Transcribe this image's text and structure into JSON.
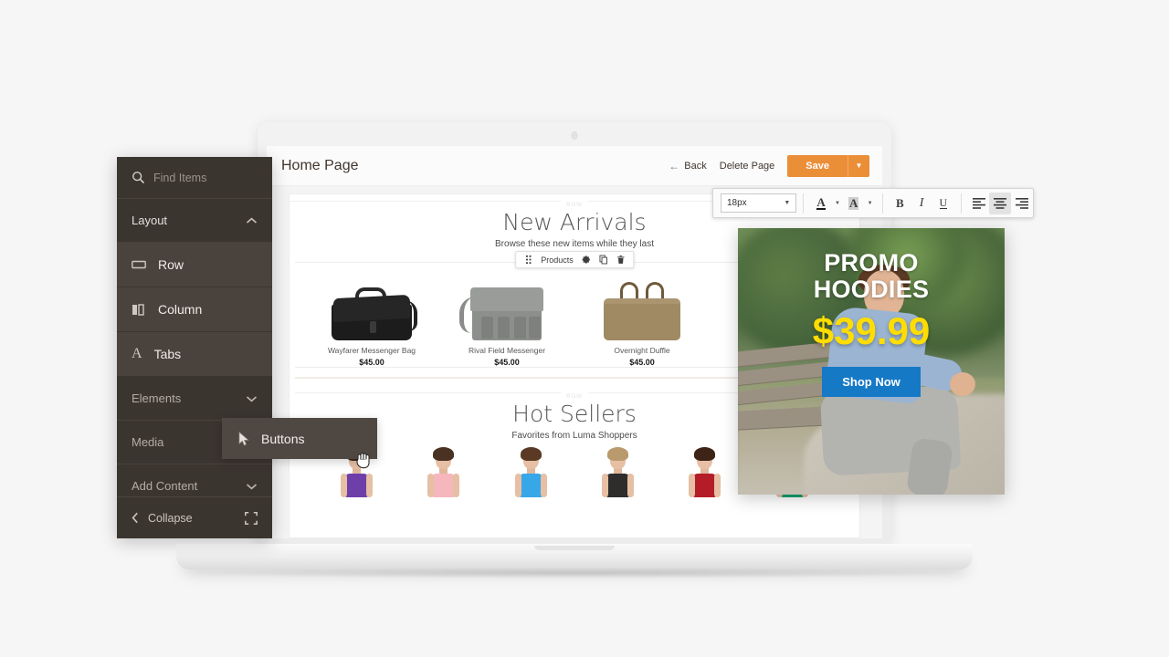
{
  "editor": {
    "page_title": "Home Page",
    "back_label": "Back",
    "delete_label": "Delete Page",
    "save_label": "Save"
  },
  "format_toolbar": {
    "font_size": "18px",
    "buttons": [
      {
        "name": "font-color",
        "glyph": "A"
      },
      {
        "name": "highlight-color",
        "glyph": "A"
      },
      {
        "name": "bold",
        "glyph": "B"
      },
      {
        "name": "italic",
        "glyph": "I"
      },
      {
        "name": "underline",
        "glyph": "U"
      },
      {
        "name": "align-left",
        "glyph": ""
      },
      {
        "name": "align-center",
        "glyph": ""
      },
      {
        "name": "align-right",
        "glyph": ""
      }
    ],
    "active_align": "align-center"
  },
  "canvas": {
    "row_label": "ROW",
    "sections": [
      {
        "title": "New Arrivals",
        "subtitle": "Browse these new items while they last"
      },
      {
        "title": "Hot Sellers",
        "subtitle": "Favorites from Luma Shoppers"
      }
    ],
    "element_toolbar": {
      "label": "Products",
      "icons": [
        "drag-handle-icon",
        "gear-icon",
        "copy-icon",
        "trash-icon"
      ]
    },
    "products": [
      {
        "name": "Wayfarer Messenger Bag",
        "price": "$45.00"
      },
      {
        "name": "Rival Field Messenger",
        "price": "$45.00"
      },
      {
        "name": "Overnight Duffle",
        "price": "$45.00"
      }
    ],
    "models": [
      {
        "top_color": "#6e3fa8"
      },
      {
        "top_color": "#f5b7bd"
      },
      {
        "top_color": "#37a7e8"
      },
      {
        "top_color": "#2f2c2c"
      },
      {
        "top_color": "#b41c28"
      },
      {
        "top_color": "#15a06d"
      }
    ]
  },
  "promo": {
    "title_line1": "PROMO",
    "title_line2": "HOODIES",
    "price": "$39.99",
    "cta": "Shop Now",
    "price_color": "#ffdd00",
    "cta_color": "#1579c6"
  },
  "panel": {
    "search_placeholder": "Find Items",
    "groups": [
      {
        "label": "Layout",
        "state": "expanded"
      },
      {
        "label": "Elements",
        "state": "collapsed"
      },
      {
        "label": "Media",
        "state": "collapsed"
      },
      {
        "label": "Add Content",
        "state": "collapsed"
      }
    ],
    "layout_items": [
      {
        "label": "Row",
        "icon": "row-icon"
      },
      {
        "label": "Column",
        "icon": "column-icon"
      },
      {
        "label": "Tabs",
        "icon": "tabs-icon"
      }
    ],
    "collapse_label": "Collapse",
    "flyout_label": "Buttons",
    "accent": "#eb8e38",
    "panel_bg": "#3b3530"
  }
}
